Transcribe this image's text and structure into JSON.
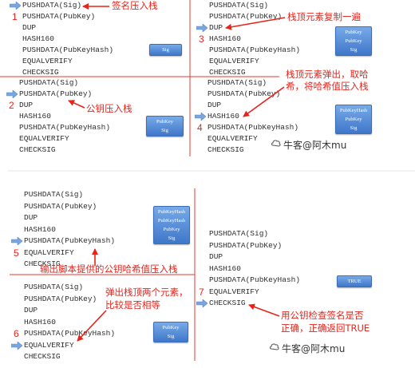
{
  "script": [
    "PUSHDATA(Sig)",
    "PUSHDATA(PubKey)",
    "DUP",
    "HASH160",
    "PUSHDATA(PubKeyHash)",
    "EQUALVERIFY",
    "CHECKSIG"
  ],
  "steps": [
    {
      "step": "1",
      "current_instruction": 0,
      "stack": [
        "Sig"
      ],
      "annotation": [
        "签名压入栈"
      ]
    },
    {
      "step": "2",
      "current_instruction": 1,
      "stack": [
        "PubKey",
        "Sig"
      ],
      "annotation": [
        "公钥压入栈"
      ]
    },
    {
      "step": "3",
      "current_instruction": 2,
      "stack": [
        "PubKey",
        "PubKey",
        "Sig"
      ],
      "annotation": [
        "栈顶元素复制一遍"
      ]
    },
    {
      "step": "4",
      "current_instruction": 3,
      "stack": [
        "PubKeyHash",
        "PubKey",
        "Sig"
      ],
      "annotation": [
        "栈顶元素弹出，取哈",
        "希，将哈希值压入栈"
      ]
    },
    {
      "step": "5",
      "current_instruction": 4,
      "stack": [
        "PubKeyHash",
        "PubKeyHash",
        "PubKey",
        "Sig"
      ],
      "annotation": [
        "输出脚本提供的公钥哈希值压入栈"
      ]
    },
    {
      "step": "6",
      "current_instruction": 5,
      "stack": [
        "PubKey",
        "Sig"
      ],
      "annotation": [
        "弹出栈顶两个元素，",
        "比较是否相等"
      ]
    },
    {
      "step": "7",
      "current_instruction": 6,
      "stack": [
        "TRUE"
      ],
      "annotation": [
        "用公钥检查签名是否",
        "正确，正确返回TRUE"
      ]
    }
  ],
  "watermark": "牛客@阿木mu",
  "colors": {
    "annotation": "#e8231a",
    "divider": "#e53935",
    "stack_top": "#78aae8",
    "stack_bottom": "#3f77c9",
    "pointer": "#7aa6de"
  },
  "icons": {
    "pointer": "pointer-arrow-icon",
    "watermark": "nowcoder-logo-icon"
  }
}
